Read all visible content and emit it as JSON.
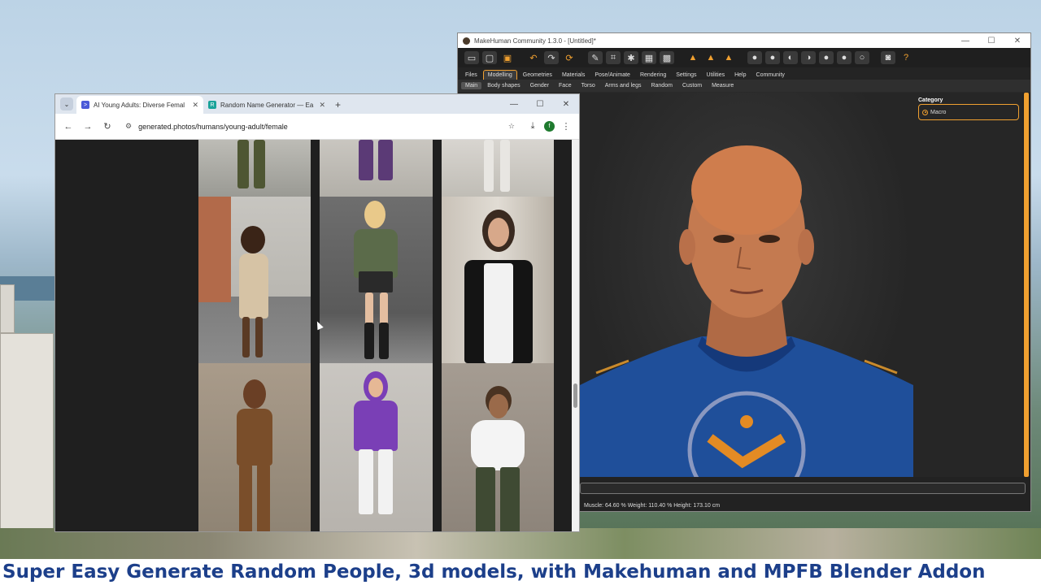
{
  "makehuman": {
    "title": "MakeHuman Community 1.3.0 - [Untitled]*",
    "main_tabs": [
      "Files",
      "Modelling",
      "Geometries",
      "Materials",
      "Pose/Animate",
      "Rendering",
      "Settings",
      "Utilities",
      "Help",
      "Community"
    ],
    "active_main_tab": "Modelling",
    "sub_tabs": [
      "Main",
      "Body shapes",
      "Gender",
      "Face",
      "Torso",
      "Arms and legs",
      "Random",
      "Custom",
      "Measure"
    ],
    "active_sub_tab": "Main",
    "category_title": "Category",
    "category_option": "Macro",
    "status": "Muscle: 64.60 %   Weight: 110.40 %   Height: 173.10 cm",
    "shirt_color": "#1f4f9a",
    "accent": "#f0a030"
  },
  "chrome": {
    "tabs": [
      {
        "title": "AI Young Adults: Diverse Femal",
        "favicon_color": "#4a5ad8",
        "favicon_glyph": ">"
      },
      {
        "title": "Random Name Generator — Ea",
        "favicon_color": "#1aa39a",
        "favicon_glyph": "R"
      }
    ],
    "url": "generated.photos/humans/young-adult/female",
    "profile_initial": "f"
  },
  "caption": "Super Easy Generate Random People, 3d models, with Makehuman and MPFB Blender Addon"
}
